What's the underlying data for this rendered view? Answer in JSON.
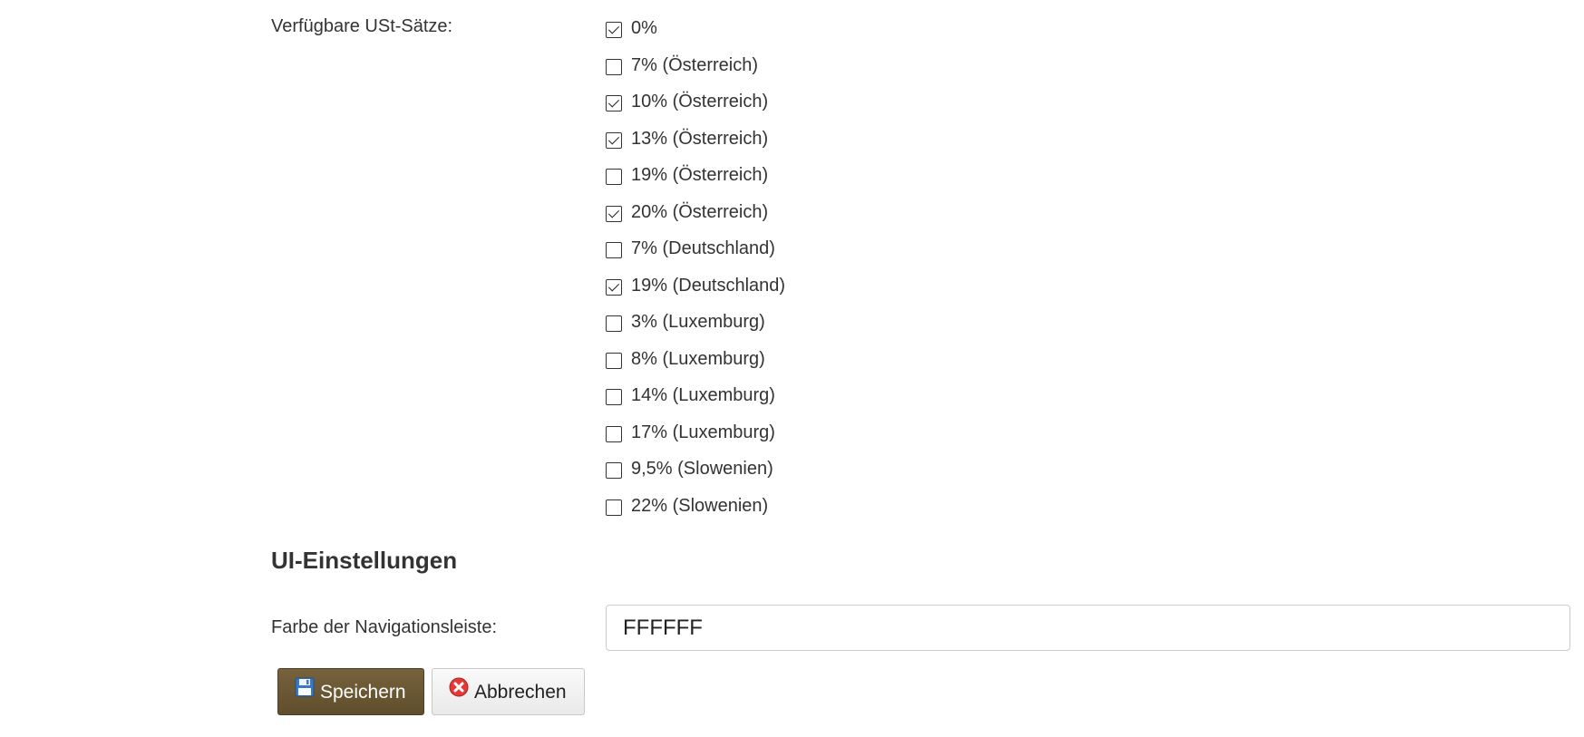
{
  "vat": {
    "label": "Verfügbare USt-Sätze:",
    "options": [
      {
        "label": "0%",
        "checked": true
      },
      {
        "label": "7% (Österreich)",
        "checked": false
      },
      {
        "label": "10% (Österreich)",
        "checked": true
      },
      {
        "label": "13% (Österreich)",
        "checked": true
      },
      {
        "label": "19% (Österreich)",
        "checked": false
      },
      {
        "label": "20% (Österreich)",
        "checked": true
      },
      {
        "label": "7% (Deutschland)",
        "checked": false
      },
      {
        "label": "19% (Deutschland)",
        "checked": true
      },
      {
        "label": "3% (Luxemburg)",
        "checked": false
      },
      {
        "label": "8% (Luxemburg)",
        "checked": false
      },
      {
        "label": "14% (Luxemburg)",
        "checked": false
      },
      {
        "label": "17% (Luxemburg)",
        "checked": false
      },
      {
        "label": "9,5% (Slowenien)",
        "checked": false
      },
      {
        "label": "22% (Slowenien)",
        "checked": false
      }
    ]
  },
  "ui_settings": {
    "title": "UI-Einstellungen",
    "nav_color_label": "Farbe der Navigationsleiste:",
    "nav_color_value": "FFFFFF"
  },
  "actions": {
    "save_label": "Speichern",
    "save_icon": "floppy-disk-icon",
    "cancel_label": "Abbrechen",
    "cancel_icon": "red-x-circle-icon"
  },
  "colors": {
    "save_button": "#6f5c36",
    "cancel_icon": "#e53935"
  }
}
